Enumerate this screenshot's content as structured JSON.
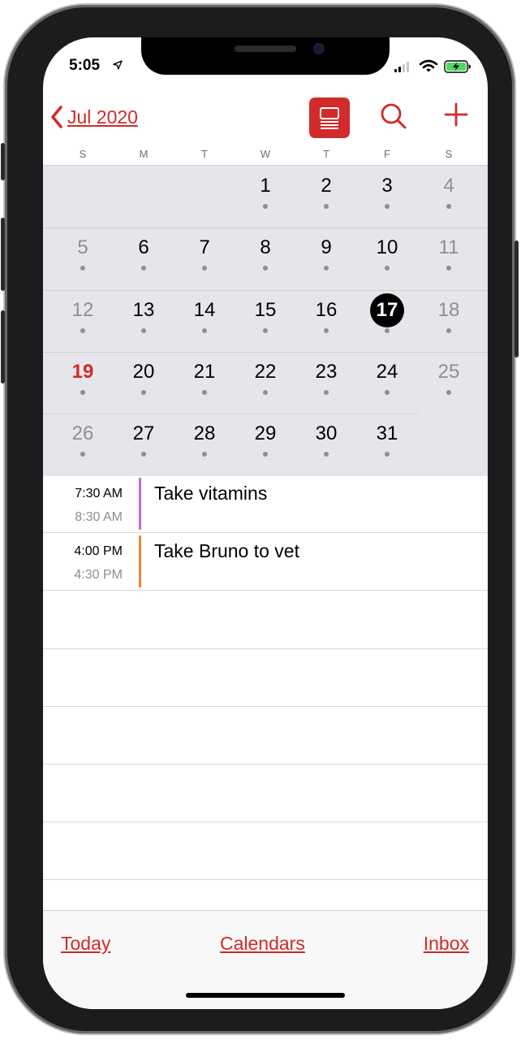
{
  "status_bar": {
    "time": "5:05"
  },
  "nav": {
    "back_label": "Jul 2020"
  },
  "weekdays": [
    "S",
    "M",
    "T",
    "W",
    "T",
    "F",
    "S"
  ],
  "weeks": [
    [
      "",
      "",
      "",
      "1",
      "2",
      "3",
      "4"
    ],
    [
      "5",
      "6",
      "7",
      "8",
      "9",
      "10",
      "11"
    ],
    [
      "12",
      "13",
      "14",
      "15",
      "16",
      "17",
      "18"
    ],
    [
      "19",
      "20",
      "21",
      "22",
      "23",
      "24",
      "25"
    ],
    [
      "26",
      "27",
      "28",
      "29",
      "30",
      "31",
      ""
    ]
  ],
  "today_day": "17",
  "highlight_day": "19",
  "events": [
    {
      "start": "7:30 AM",
      "end": "8:30 AM",
      "title": "Take vitamins",
      "color": "#c36ad6"
    },
    {
      "start": "4:00 PM",
      "end": "4:30 PM",
      "title": "Take Bruno to vet",
      "color": "#e8843a"
    }
  ],
  "toolbar": {
    "today_label": "Today",
    "calendars_label": "Calendars",
    "inbox_label": "Inbox"
  },
  "colors": {
    "accent": "#d12a2a",
    "grid_bg": "#e5e5ea"
  },
  "icons": {
    "back": "chevron-left-icon",
    "list": "list-view-icon",
    "search": "search-icon",
    "add": "plus-icon",
    "location": "location-arrow-icon",
    "signal": "cellular-signal-icon",
    "wifi": "wifi-icon",
    "battery": "battery-charging-icon"
  }
}
